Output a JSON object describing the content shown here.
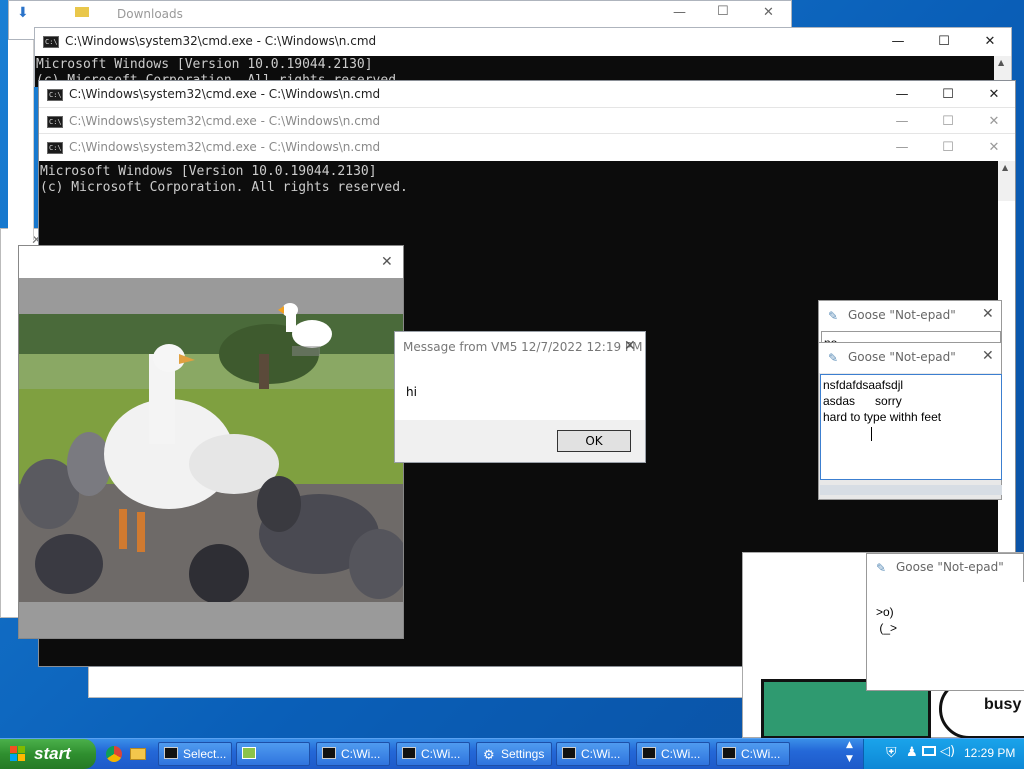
{
  "explorer": {
    "title": "Downloads"
  },
  "cmd_back": {
    "title": "C:\\Windows\\system32\\cmd.exe - C:\\Windows\\n.cmd",
    "line1": "Microsoft Windows [Version 10.0.19044.2130]",
    "line2": "(c) Microsoft Corporation. All rights reserved."
  },
  "cmd_stack": [
    {
      "title": "C:\\Windows\\system32\\cmd.exe - C:\\Windows\\n.cmd"
    },
    {
      "title": "C:\\Windows\\system32\\cmd.exe - C:\\Windows\\n.cmd"
    },
    {
      "title": "C:\\Windows\\system32\\cmd.exe - C:\\Windows\\n.cmd"
    }
  ],
  "cmd_front": {
    "line1": "Microsoft Windows [Version 10.0.19044.2130]",
    "line2": "(c) Microsoft Corporation. All rights reserved."
  },
  "message_box": {
    "title": "Message from VM5 12/7/2022 12:19 PM",
    "body": "hi",
    "ok_label": "OK"
  },
  "notepad_1": {
    "title": "Goose \"Not-epad\"",
    "partial_text": "no"
  },
  "notepad_2": {
    "title": "Goose \"Not-epad\"",
    "text": "nsfdafdsaafsdjl\nasdas      sorry\nhard to type withh feet"
  },
  "notepad_3": {
    "title": "Goose \"Not-epad\"",
    "text": ">o)\n (_>"
  },
  "comic": {
    "bubble_text": "busy"
  },
  "taskbar": {
    "start_label": "start",
    "buttons": [
      {
        "label": "Select..."
      },
      {
        "label": ""
      },
      {
        "label": "C:\\Wi..."
      },
      {
        "label": "C:\\Wi..."
      },
      {
        "label": "Settings"
      },
      {
        "label": "C:\\Wi..."
      },
      {
        "label": "C:\\Wi..."
      },
      {
        "label": "C:\\Wi..."
      }
    ],
    "clock": "12:29 PM"
  },
  "colors": {
    "desktop": "#1a7fd4",
    "console_bg": "#0c0c0c",
    "start_green": "#2f8f2f",
    "taskbar_blue": "#2468d8"
  }
}
